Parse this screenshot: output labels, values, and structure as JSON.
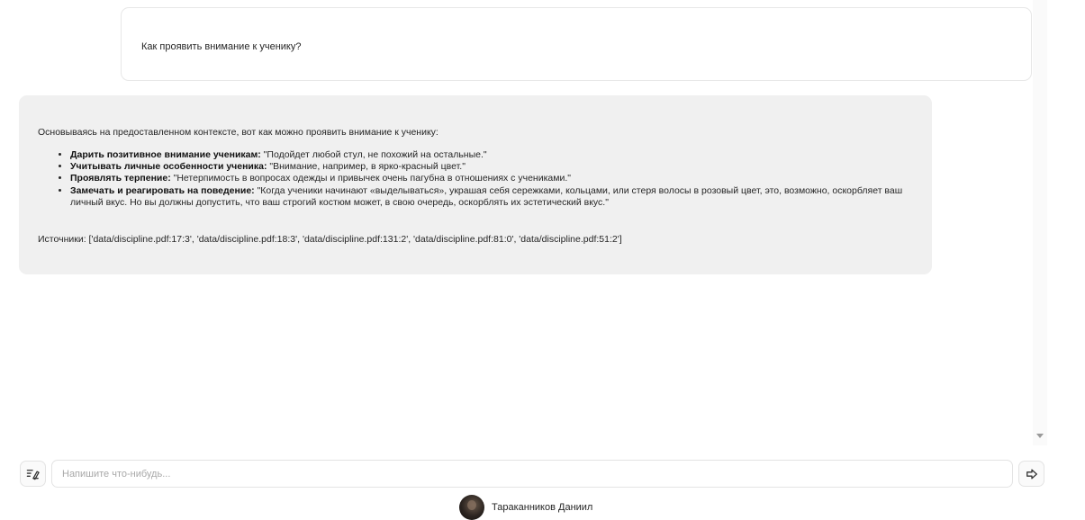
{
  "chat": {
    "user_message": "Как проявить внимание к ученику?",
    "bot_message": {
      "intro": "Основываясь на предоставленном контексте, вот как можно проявить внимание к ученику:",
      "items": [
        {
          "title": "Дарить позитивное внимание ученикам:",
          "text": " \"Подойдет любой стул, не похожий на остальные.\""
        },
        {
          "title": "Учитывать личные особенности ученика:",
          "text": " \"Внимание, например, в ярко-красный цвет.\""
        },
        {
          "title": "Проявлять терпение:",
          "text": " \"Нетерпимость в вопросах одежды и привычек очень пагубна в отношениях с учениками.\""
        },
        {
          "title": "Замечать и реагировать на поведение:",
          "text": " \"Когда ученики начинают «выделываться», украшая себя сережками, кольцами, или стеря волосы в розовый цвет, это, возможно, оскорбляет ваш личный вкус. Но вы должны допустить, что ваш строгий костюм может, в свою очередь, оскорблять их эстетический вкус.\""
        }
      ],
      "sources": "Источники: ['data/discipline.pdf:17:3', 'data/discipline.pdf:18:3', 'data/discipline.pdf:131:2', 'data/discipline.pdf:81:0', 'data/discipline.pdf:51:2']"
    }
  },
  "input": {
    "placeholder": "Напишите что-нибудь..."
  },
  "icons": {
    "clear": "clear-chat-icon",
    "send": "send-icon",
    "scroll": "scroll-down-arrow-icon"
  },
  "footer": {
    "username": "Тараканников Даниил"
  }
}
